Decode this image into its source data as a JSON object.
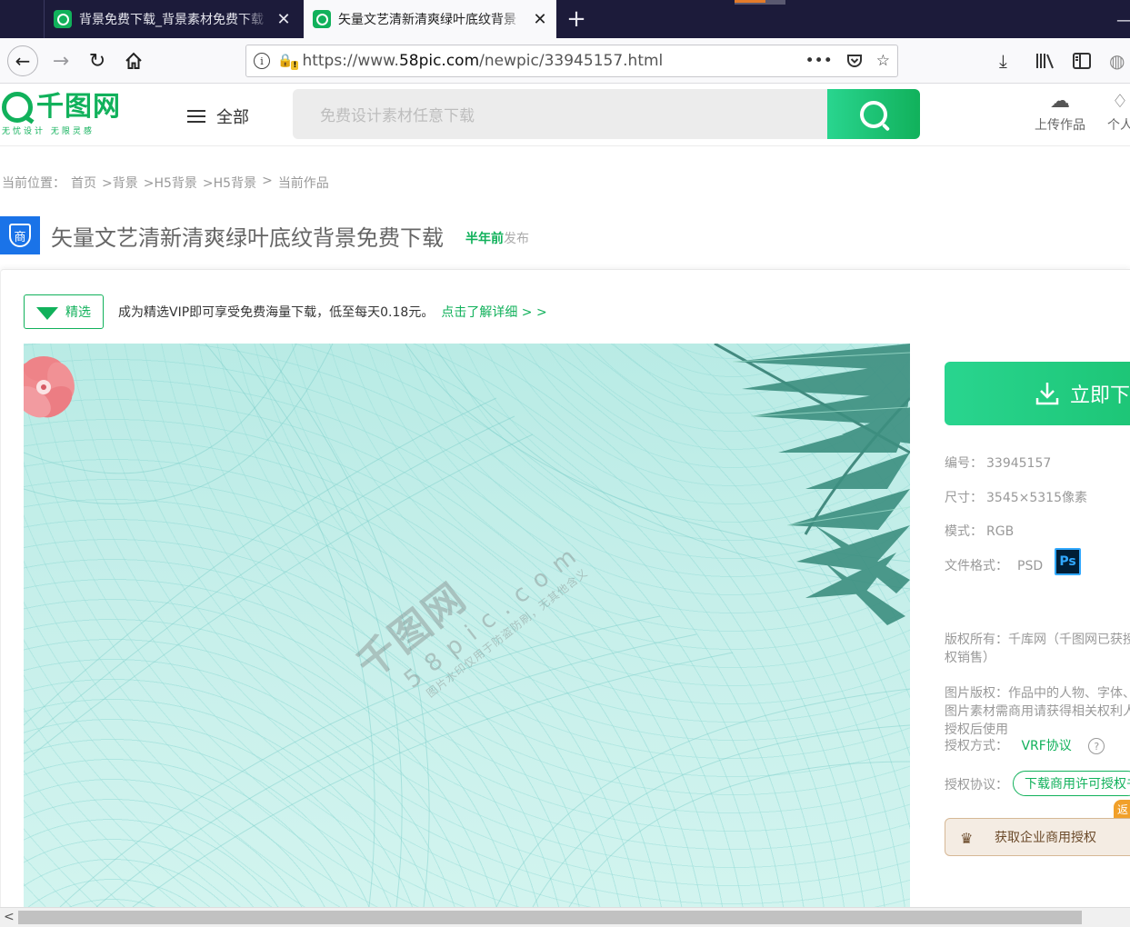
{
  "browser": {
    "tabs": [
      {
        "title": "背景免费下载_背景素材免费下载",
        "active": false
      },
      {
        "title": "矢量文艺清新清爽绿叶底纹背景",
        "active": true
      }
    ],
    "new_tab": "+",
    "url_prefix": "https://www.",
    "url_domain": "58pic.com",
    "url_path": "/newpic/33945157.html",
    "page_actions": "•••"
  },
  "site": {
    "logo_text": "千图网",
    "logo_tagline": "无忧设计 无限灵感",
    "menu_all": "全部",
    "search_placeholder": "免费设计素材任意下载",
    "upload_label": "上传作品",
    "personal_label": "个人"
  },
  "breadcrumb": [
    "当前位置：",
    "首页",
    ">背景",
    ">H5背景",
    ">H5背景",
    ">",
    "当前作品"
  ],
  "title": {
    "badge": "商",
    "text": "矢量文艺清新清爽绿叶底纹背景免费下载",
    "time": "半年前",
    "time_suffix": "发布"
  },
  "vip": {
    "badge": "精选",
    "text": "成为精选VIP即可享受免费海量下载，低至每天0.18元。",
    "link": "点击了解详细 > >"
  },
  "watermark": {
    "logo": "千图网",
    "domain": "58pic.com",
    "note": "图片水印仅用于防盗防刷，无其他含义"
  },
  "details": {
    "download_label": "立即下载",
    "id_label": "编号：",
    "id_value": "33945157",
    "size_label": "尺寸：",
    "size_value": "3545×5315像素",
    "mode_label": "模式：",
    "mode_value": "RGB",
    "format_label": "文件格式：",
    "format_value": "PSD",
    "ps_icon_label": "Ps",
    "copyright_label": "版权所有：",
    "copyright_value": "千库网（千图网已获授权销售）",
    "image_rights_label": "图片版权：",
    "image_rights_value": "作品中的人物、字体、图片素材需商用请获得相关权利人授权后使用",
    "license_method_label": "授权方式：",
    "license_method_value": "VRF协议",
    "license_agreement_label": "授权协议：",
    "license_button": "下载商用许可授权书",
    "return_tag": "返",
    "enterprise_button": "获取企业商用授权"
  },
  "colors": {
    "brand_green": "#11b15b",
    "tab_bar": "#1c1b3a",
    "badge_blue": "#1a73e8",
    "enterprise_bg": "#f4ece3"
  }
}
